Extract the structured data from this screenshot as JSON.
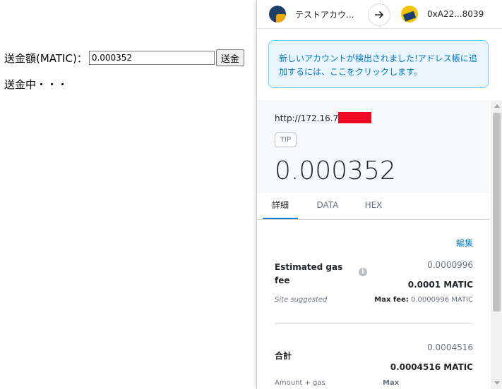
{
  "page": {
    "amount_label": "送金額(MATIC)：",
    "amount_value": "0.000352",
    "send_button": "送金",
    "status": "送金中・・・"
  },
  "wallet": {
    "from_account": "テストアカウ...",
    "to_account": "0xA22...8039",
    "notice": "新しいアカウントが検出されました!アドレス帳に追加するには、ここをクリックします。",
    "origin": "http://172.16.7",
    "badge": "TIP",
    "amount": "0.000352",
    "tabs": [
      "詳細",
      "DATA",
      "HEX"
    ],
    "edit": "編集",
    "gas": {
      "label": "Estimated gas fee",
      "info_icon": "i",
      "sub_value": "0.0000996",
      "main_value": "0.0001 MATIC",
      "site_suggested": "Site suggested",
      "max_fee_label": "Max fee:",
      "max_fee_value": "0.0000996 MATIC"
    },
    "total": {
      "label": "合計",
      "sub_value": "0.0004516",
      "main_value": "0.0004516 MATIC",
      "amount_gas": "Amount + gas",
      "max_label": "Max"
    }
  },
  "colors": {
    "accent": "#037dd6",
    "notice_bg": "#eaf6ff",
    "redaction": "#ee0a20"
  }
}
